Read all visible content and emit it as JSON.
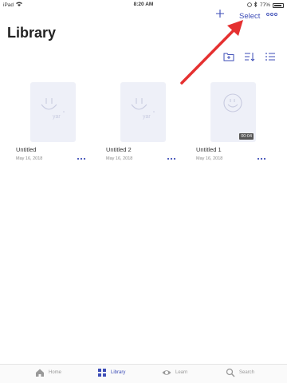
{
  "status_bar": {
    "device": "iPad",
    "time": "8:20 AM",
    "battery": "77%"
  },
  "top_bar": {
    "add_icon": "plus-icon",
    "select_label": "Select",
    "more_icon": "ellipsis-icon"
  },
  "page": {
    "title": "Library"
  },
  "toolbar": {
    "icons": [
      "new-folder-icon",
      "sort-icon",
      "list-view-icon"
    ]
  },
  "items": [
    {
      "title": "Untitled",
      "date": "May 16, 2018",
      "duration": ""
    },
    {
      "title": "Untitled 2",
      "date": "May 16, 2018",
      "duration": ""
    },
    {
      "title": "Untitled 1",
      "date": "May 16, 2018",
      "duration": "00:04"
    }
  ],
  "tab_bar": {
    "tabs": [
      {
        "label": "Home",
        "icon": "house-icon",
        "active": false
      },
      {
        "label": "Library",
        "icon": "grid-icon",
        "active": true
      },
      {
        "label": "Learn",
        "icon": "eye-icon",
        "active": false
      },
      {
        "label": "Search",
        "icon": "magnifier-icon",
        "active": false
      }
    ]
  },
  "colors": {
    "accent": "#3d4db7",
    "annotation_arrow": "#e53030",
    "thumbnail_bg": "#eef0f8"
  }
}
